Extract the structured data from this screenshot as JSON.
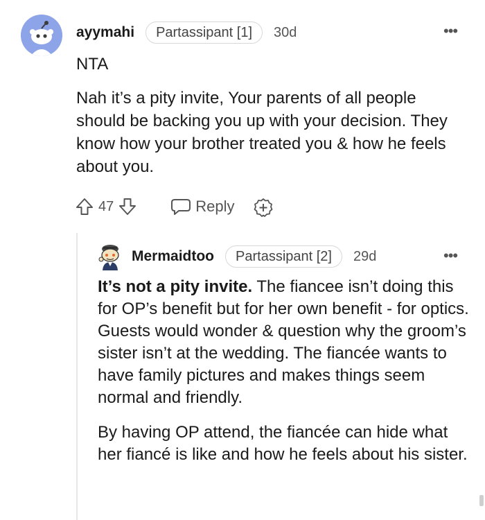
{
  "comment1": {
    "username": "ayymahi",
    "flair": "Partassipant [1]",
    "age": "30d",
    "verdict": "NTA",
    "body": "Nah it’s a pity invite, Your parents of all people should be backing you up with your decision. They know how your brother treated you & how he feels about you.",
    "votes": "47",
    "reply_label": "Reply"
  },
  "comment2": {
    "username": "Mermaidtoo",
    "flair": "Partassipant [2]",
    "age": "29d",
    "lead": "It’s not a pity invite.",
    "para1_rest": " The fiancee isn’t doing this for OP’s benefit but for her own benefit - for optics. Guests would wonder & question why the groom’s sister isn’t at the wedding. The fiancée wants to have family pictures and makes things seem normal and friendly.",
    "para2": "By having OP attend, the fiancée can hide what her fiancé is like and how he feels about his sister."
  },
  "icons": {
    "upvote": "upvote-arrow-icon",
    "downvote": "downvote-arrow-icon",
    "reply": "speech-bubble-icon",
    "award": "award-plus-icon",
    "more": "more-dots-icon"
  },
  "colors": {
    "avatar_bg": "#8ea4e8",
    "text": "#1a1a1b",
    "muted": "#555555"
  }
}
